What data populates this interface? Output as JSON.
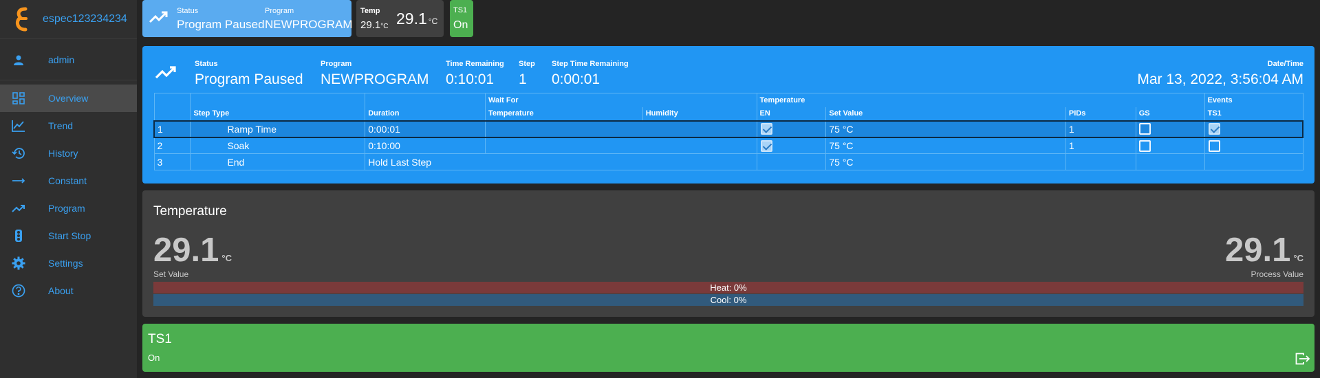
{
  "brand": {
    "name": "espec123234234",
    "logo_color": "#f7941d"
  },
  "user": {
    "name": "admin"
  },
  "nav": [
    {
      "label": "Overview",
      "icon": "dashboard-icon",
      "active": true
    },
    {
      "label": "Trend",
      "icon": "line-chart-icon"
    },
    {
      "label": "History",
      "icon": "history-icon"
    },
    {
      "label": "Constant",
      "icon": "arrow-right-icon"
    },
    {
      "label": "Program",
      "icon": "trending-up-icon"
    },
    {
      "label": "Start Stop",
      "icon": "traffic-light-icon"
    },
    {
      "label": "Settings",
      "icon": "gear-icon"
    },
    {
      "label": "About",
      "icon": "help-icon"
    }
  ],
  "topbar": {
    "status_key": "Status",
    "status_val": "Program Paused",
    "program_key": "Program",
    "program_val": "NEWPROGRAM",
    "temp_key": "Temp",
    "temp_small": "29.1",
    "temp_small_unit": "°C",
    "temp_big": "29.1",
    "temp_big_unit": "°C",
    "ts1_key": "TS1",
    "ts1_val": "On"
  },
  "program": {
    "status_key": "Status",
    "status_val": "Program Paused",
    "program_key": "Program",
    "program_val": "NEWPROGRAM",
    "time_remaining_key": "Time Remaining",
    "time_remaining_val": "0:10:01",
    "step_key": "Step",
    "step_val": "1",
    "step_time_key": "Step Time Remaining",
    "step_time_val": "0:00:01",
    "datetime_key": "Date/Time",
    "datetime_val": "Mar 13, 2022, 3:56:04 AM",
    "headers": {
      "wait_for": "Wait For",
      "temperature": "Temperature",
      "events": "Events",
      "step_type": "Step Type",
      "duration": "Duration",
      "wait_temp": "Temperature",
      "wait_humidity": "Humidity",
      "en": "EN",
      "set_value": "Set Value",
      "pids": "PIDs",
      "gs": "GS",
      "ts1": "TS1"
    },
    "steps": [
      {
        "num": "1",
        "type": "Ramp Time",
        "duration": "0:00:01",
        "en": true,
        "set_value": "75 °C",
        "pids": "1",
        "gs": false,
        "ts1": true
      },
      {
        "num": "2",
        "type": "Soak",
        "duration": "0:10:00",
        "en": true,
        "set_value": "75 °C",
        "pids": "1",
        "gs": false,
        "ts1": false
      },
      {
        "num": "3",
        "type": "End",
        "duration": "Hold Last Step",
        "set_value": "75 °C"
      }
    ]
  },
  "temperature": {
    "title": "Temperature",
    "set_value": "29.1",
    "set_unit": "°C",
    "set_caption": "Set Value",
    "process_value": "29.1",
    "process_unit": "°C",
    "process_caption": "Process Value",
    "heat": "Heat: 0%",
    "cool": "Cool: 0%"
  },
  "ts1": {
    "title": "TS1",
    "value": "On"
  },
  "colors": {
    "accent": "#2196f3",
    "status_card": "#5aabf0",
    "ok_green": "#4caf50",
    "heat": "#7a3a3a",
    "cool": "#315a7c",
    "link": "#3aa0f0"
  }
}
